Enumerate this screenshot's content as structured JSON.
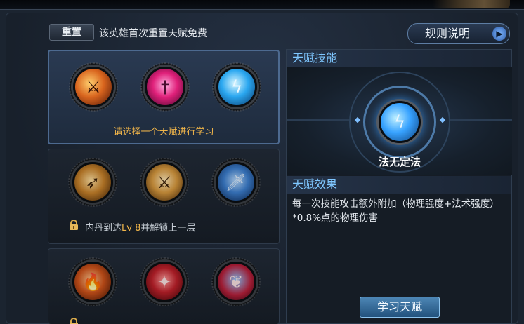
{
  "header": {
    "reset_label": "重置",
    "reset_note": "该英雄首次重置天赋免费",
    "rules_label": "规则说明"
  },
  "tiers": [
    {
      "status": "active",
      "prompt": "请选择一个天赋进行学习",
      "skills": [
        {
          "icon": "blade-fire-icon",
          "color": "#d9651e"
        },
        {
          "icon": "dagger-pink-icon",
          "color": "#e0207a"
        },
        {
          "icon": "lightning-blade-icon",
          "color": "#2aa7f0"
        }
      ]
    },
    {
      "status": "locked",
      "lock_prefix": "内丹到达",
      "lock_level": "Lv 8",
      "lock_suffix": "并解锁上一层",
      "skills": [
        {
          "icon": "spear-golden-icon",
          "color": "#c8822a"
        },
        {
          "icon": "sword-slash-icon",
          "color": "#d99a3e"
        },
        {
          "icon": "blue-sword-icon",
          "color": "#3c7fd0"
        }
      ]
    },
    {
      "status": "locked",
      "skills": [
        {
          "icon": "fire-lance-icon",
          "color": "#d0531a"
        },
        {
          "icon": "red-strike-icon",
          "color": "#c0202a"
        },
        {
          "icon": "red-wing-icon",
          "color": "#b81f3a"
        }
      ]
    }
  ],
  "detail": {
    "skill_section_title": "天赋技能",
    "skill_name": "法无定法",
    "effect_section_title": "天赋效果",
    "effect_text": "每一次技能攻击额外附加（物理强度+法术强度）*0.8%点的物理伤害",
    "learn_button": "学习天赋"
  },
  "colors": {
    "accent_gold": "#f0b54a",
    "accent_blue": "#7fc7ff"
  }
}
